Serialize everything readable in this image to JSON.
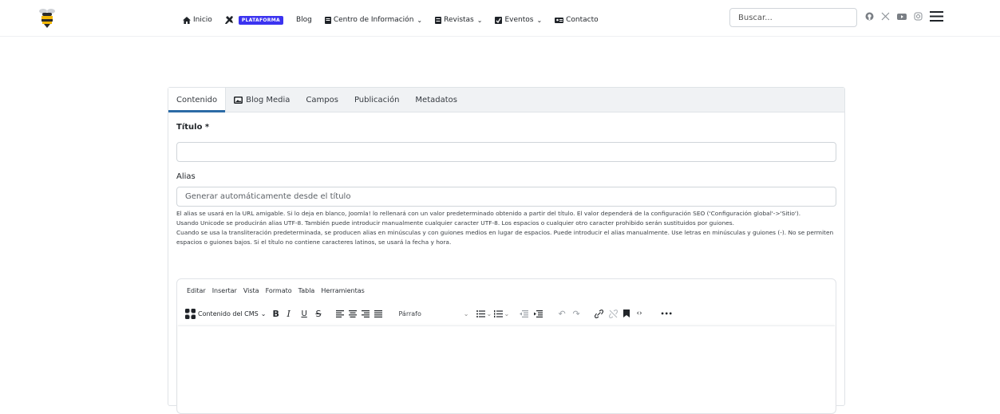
{
  "header": {
    "logo_alt": "bee-logo",
    "nav": [
      {
        "label": "Inicio",
        "icon": "home-icon"
      },
      {
        "label": "",
        "icon": "tools-icon",
        "badge": "PLATAFORMA"
      },
      {
        "label": "Blog",
        "icon": ""
      },
      {
        "label": "Centro de Información",
        "icon": "book-icon",
        "dropdown": true
      },
      {
        "label": "Revistas",
        "icon": "magazine-icon",
        "dropdown": true
      },
      {
        "label": "Eventos",
        "icon": "calendar-check-icon",
        "dropdown": true
      },
      {
        "label": "Contacto",
        "icon": "contact-card-icon"
      }
    ],
    "search_placeholder": "Buscar...",
    "social_icons": [
      "github-icon",
      "x-icon",
      "youtube-icon",
      "instagram-icon",
      "hamburger-menu-icon"
    ],
    "accent": "#3b33f0"
  },
  "form": {
    "tabs": [
      {
        "label": "Contenido",
        "active": true
      },
      {
        "label": "Blog Media",
        "icon": "image-icon"
      },
      {
        "label": "Campos"
      },
      {
        "label": "Publicación"
      },
      {
        "label": "Metadatos"
      }
    ],
    "title_label": "Título",
    "required_mark": " *",
    "title_value": "",
    "alias_label": "Alias",
    "alias_placeholder": "Generar automáticamente desde el título",
    "alias_help_1": "El alias se usará en la URL amigable. Si lo deja en blanco, Joomla! lo rellenará con un valor predeterminado obtenido a partir del título. El valor dependerá de la configuración SEO ('Configuración global'->'Sitio').",
    "alias_help_2": "Usando Unicode se producirán alias UTF-8. También puede introducir manualmente cualquier caracter UTF-8. Los espacios o cualquier otro caracter prohibido serán sustituidos por guiones.",
    "alias_help_3": "Cuando se usa la transliteración predeterminada, se producen alias en minúsculas y con guiones medios en lugar de espacios. Puede introducir el alias manualmente. Use letras en minúsculas y guiones (-). No se permiten espacios o guiones bajos. Si el título no contiene caracteres latinos, se usará la fecha y hora."
  },
  "editor": {
    "menu": [
      "Editar",
      "Insertar",
      "Vista",
      "Formato",
      "Tabla",
      "Herramientas"
    ],
    "cms_content_label": "Contenido del CMS",
    "block_format": "Párrafo",
    "more_label": "•••"
  }
}
